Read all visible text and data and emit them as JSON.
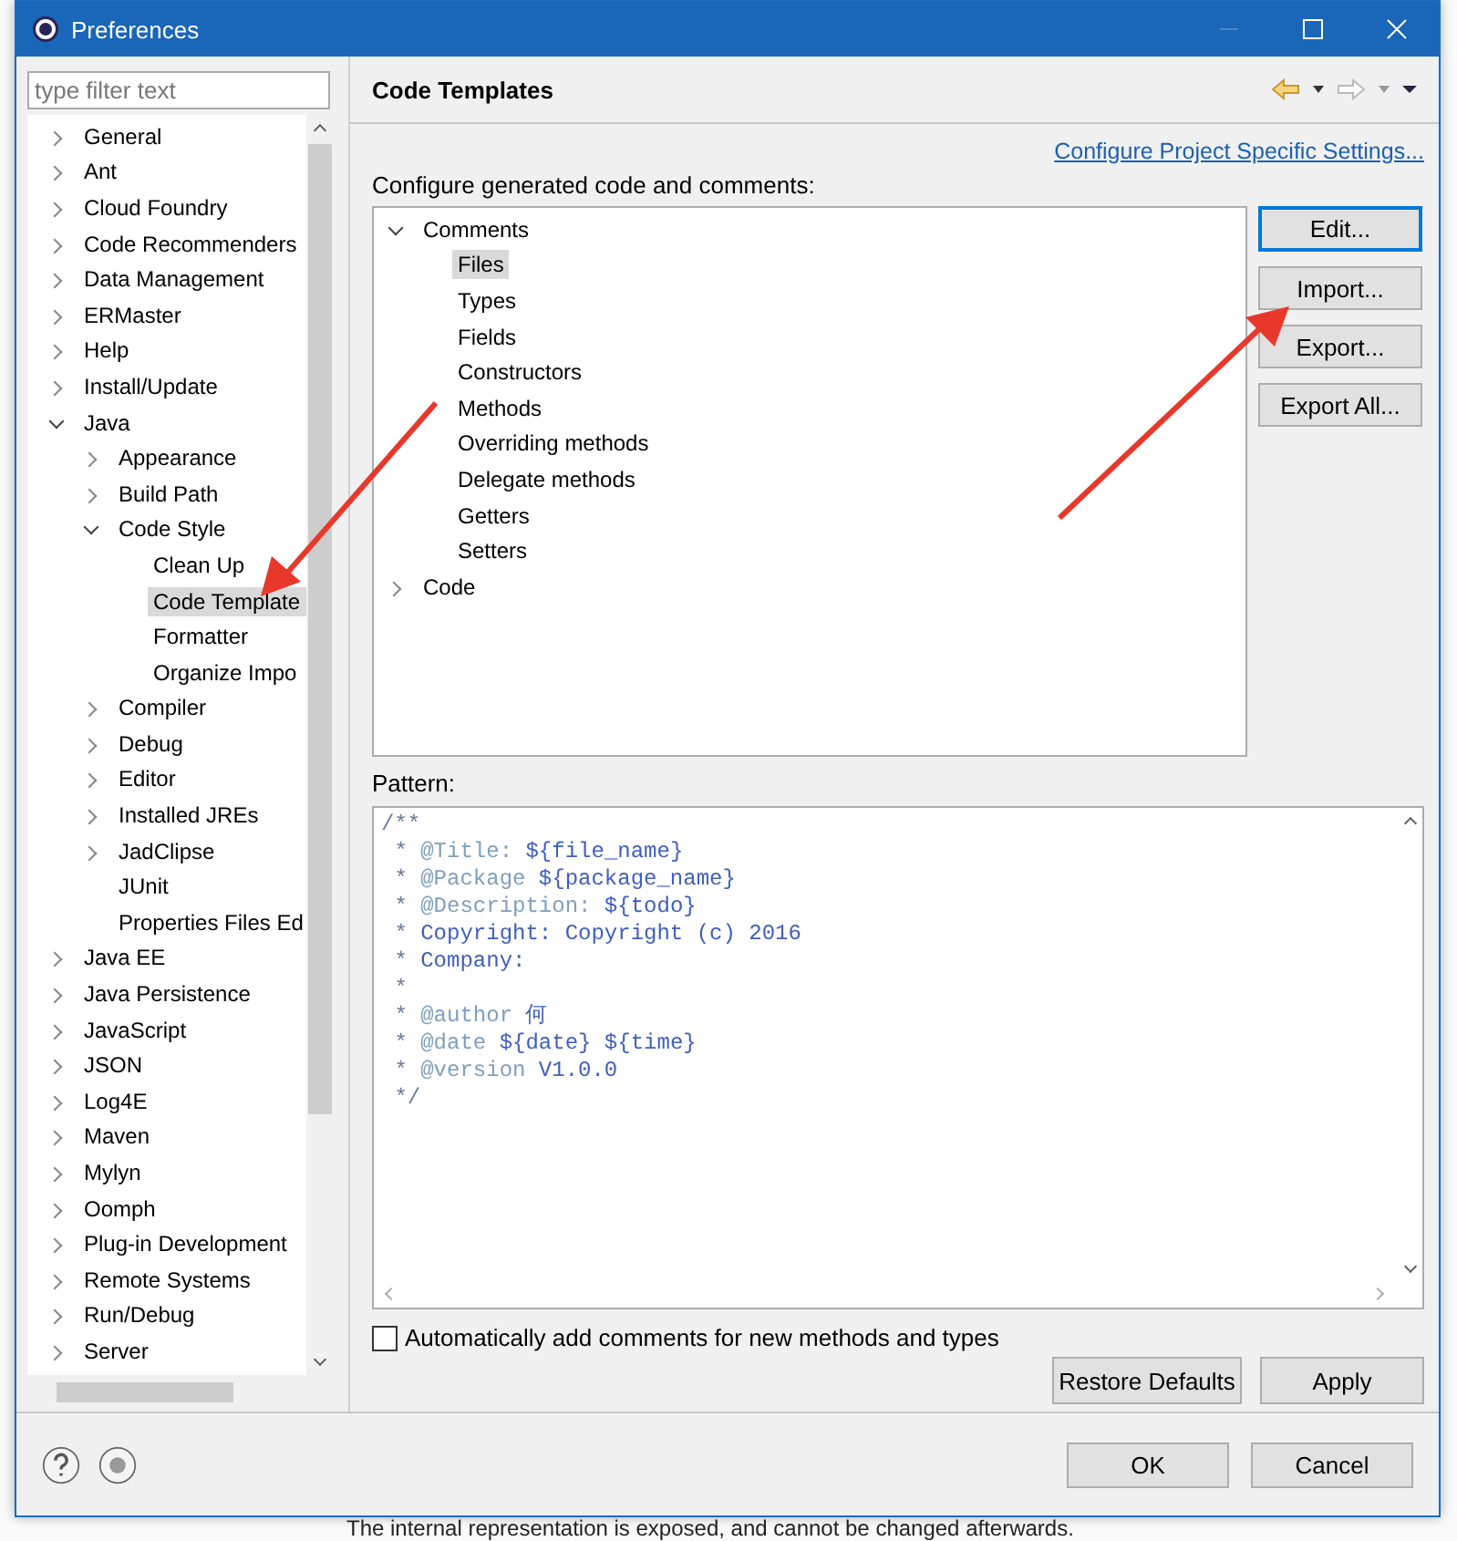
{
  "window": {
    "title": "Preferences"
  },
  "filter": {
    "placeholder": "type filter text"
  },
  "sidebar": {
    "items": [
      {
        "label": "General",
        "expanded": false,
        "selected": false
      },
      {
        "label": "Ant",
        "expanded": false,
        "selected": false
      },
      {
        "label": "Cloud Foundry",
        "expanded": false,
        "selected": false
      },
      {
        "label": "Code Recommenders",
        "expanded": false,
        "selected": false
      },
      {
        "label": "Data Management",
        "expanded": false,
        "selected": false
      },
      {
        "label": "ERMaster",
        "expanded": false,
        "selected": false
      },
      {
        "label": "Help",
        "expanded": false,
        "selected": false
      },
      {
        "label": "Install/Update",
        "expanded": false,
        "selected": false
      },
      {
        "label": "Java",
        "expanded": true,
        "selected": false,
        "children": [
          {
            "label": "Appearance",
            "expanded": false,
            "selected": false
          },
          {
            "label": "Build Path",
            "expanded": false,
            "selected": false
          },
          {
            "label": "Code Style",
            "expanded": true,
            "selected": false,
            "children": [
              {
                "label": "Clean Up",
                "selected": false
              },
              {
                "label": "Code Template",
                "selected": true
              },
              {
                "label": "Formatter",
                "selected": false
              },
              {
                "label": "Organize Impo",
                "selected": false
              }
            ]
          },
          {
            "label": "Compiler",
            "expanded": false,
            "selected": false
          },
          {
            "label": "Debug",
            "expanded": false,
            "selected": false
          },
          {
            "label": "Editor",
            "expanded": false,
            "selected": false
          },
          {
            "label": "Installed JREs",
            "expanded": false,
            "selected": false
          },
          {
            "label": "JadClipse",
            "expanded": false,
            "selected": false
          },
          {
            "label": "JUnit",
            "selected": false
          },
          {
            "label": "Properties Files Ed",
            "selected": false
          }
        ]
      },
      {
        "label": "Java EE",
        "expanded": false,
        "selected": false
      },
      {
        "label": "Java Persistence",
        "expanded": false,
        "selected": false
      },
      {
        "label": "JavaScript",
        "expanded": false,
        "selected": false
      },
      {
        "label": "JSON",
        "expanded": false,
        "selected": false
      },
      {
        "label": "Log4E",
        "expanded": false,
        "selected": false
      },
      {
        "label": "Maven",
        "expanded": false,
        "selected": false
      },
      {
        "label": "Mylyn",
        "expanded": false,
        "selected": false
      },
      {
        "label": "Oomph",
        "expanded": false,
        "selected": false
      },
      {
        "label": "Plug-in Development",
        "expanded": false,
        "selected": false
      },
      {
        "label": "Remote Systems",
        "expanded": false,
        "selected": false
      },
      {
        "label": "Run/Debug",
        "expanded": false,
        "selected": false
      },
      {
        "label": "Server",
        "expanded": false,
        "selected": false
      }
    ]
  },
  "page": {
    "title": "Code Templates",
    "link": "Configure Project Specific Settings...",
    "description": "Configure generated code and comments:"
  },
  "templates": [
    {
      "label": "Comments",
      "expanded": true,
      "selected": false,
      "children": [
        {
          "label": "Files",
          "selected": true
        },
        {
          "label": "Types",
          "selected": false
        },
        {
          "label": "Fields",
          "selected": false
        },
        {
          "label": "Constructors",
          "selected": false
        },
        {
          "label": "Methods",
          "selected": false
        },
        {
          "label": "Overriding methods",
          "selected": false
        },
        {
          "label": "Delegate methods",
          "selected": false
        },
        {
          "label": "Getters",
          "selected": false
        },
        {
          "label": "Setters",
          "selected": false
        }
      ]
    },
    {
      "label": "Code",
      "expanded": false,
      "selected": false
    }
  ],
  "side_buttons": [
    "Edit...",
    "Import...",
    "Export...",
    "Export All..."
  ],
  "pattern": {
    "label": "Pattern:",
    "lines": [
      {
        "kind": "comment",
        "text": "/**"
      },
      {
        "kind": "tag",
        "star": " * ",
        "tag": "@Title:",
        "rest": " ${file_name}"
      },
      {
        "kind": "tag",
        "star": " * ",
        "tag": "@Package",
        "rest": " ${package_name}"
      },
      {
        "kind": "tag",
        "star": " * ",
        "tag": "@Description:",
        "rest": " ${todo}"
      },
      {
        "kind": "tag",
        "star": " * ",
        "rest": "Copyright: Copyright (c) 2016"
      },
      {
        "kind": "tag",
        "star": " * ",
        "rest": "Company:"
      },
      {
        "kind": "comment",
        "text": " *"
      },
      {
        "kind": "tag",
        "star": " * ",
        "tag": "@author",
        "rest": " 何"
      },
      {
        "kind": "tag",
        "star": " * ",
        "tag": "@date",
        "rest": " ${date} ${time}"
      },
      {
        "kind": "tag",
        "star": " * ",
        "tag": "@version",
        "rest": " V1.0.0"
      },
      {
        "kind": "comment",
        "text": " */"
      }
    ]
  },
  "auto_comments": {
    "label": "Automatically add comments for new methods and types",
    "checked": false
  },
  "page_buttons": [
    "Restore Defaults",
    "Apply"
  ],
  "dialog_buttons": [
    "OK",
    "Cancel"
  ],
  "background_text": "The internal representation is exposed, and cannot be changed afterwards."
}
